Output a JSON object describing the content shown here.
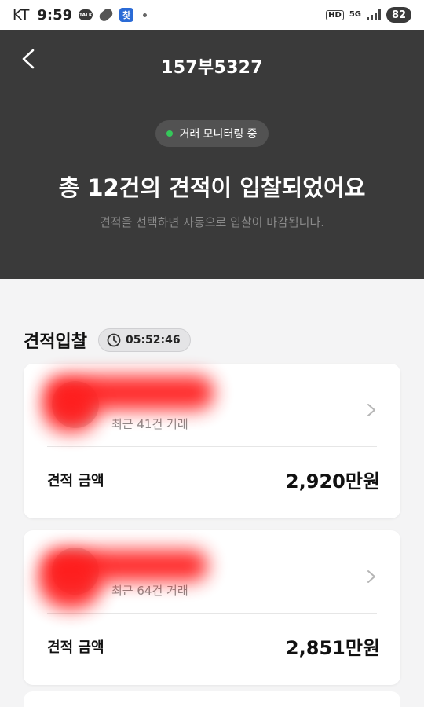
{
  "status_bar": {
    "carrier": "KT",
    "time": "9:59",
    "talk_icon_text": "TALK",
    "app_icon_text": "찾",
    "hd_text": "HD",
    "network": "5G",
    "battery": "82"
  },
  "header": {
    "plate_number": "157부5327",
    "monitoring_label": "거래 모니터링 중",
    "headline": "총 12건의 견적이 입찰되었어요",
    "subtext": "견적을 선택하면 자동으로 입찰이 마감됩니다."
  },
  "section": {
    "title": "견적입찰",
    "timer": "05:52:46"
  },
  "bids": [
    {
      "dealer_name": "",
      "trades": "최근 41건 거래",
      "amount_label": "견적 금액",
      "amount": "2,920만원"
    },
    {
      "dealer_name": "",
      "trades": "최근 64건 거래",
      "amount_label": "견적 금액",
      "amount": "2,851만원"
    }
  ],
  "colors": {
    "header_bg": "#3a3a3a",
    "status_green": "#35c85a",
    "redaction": "#ff1a1a"
  },
  "icons": [
    "back-arrow-icon",
    "clock-icon",
    "chevron-right-icon"
  ]
}
